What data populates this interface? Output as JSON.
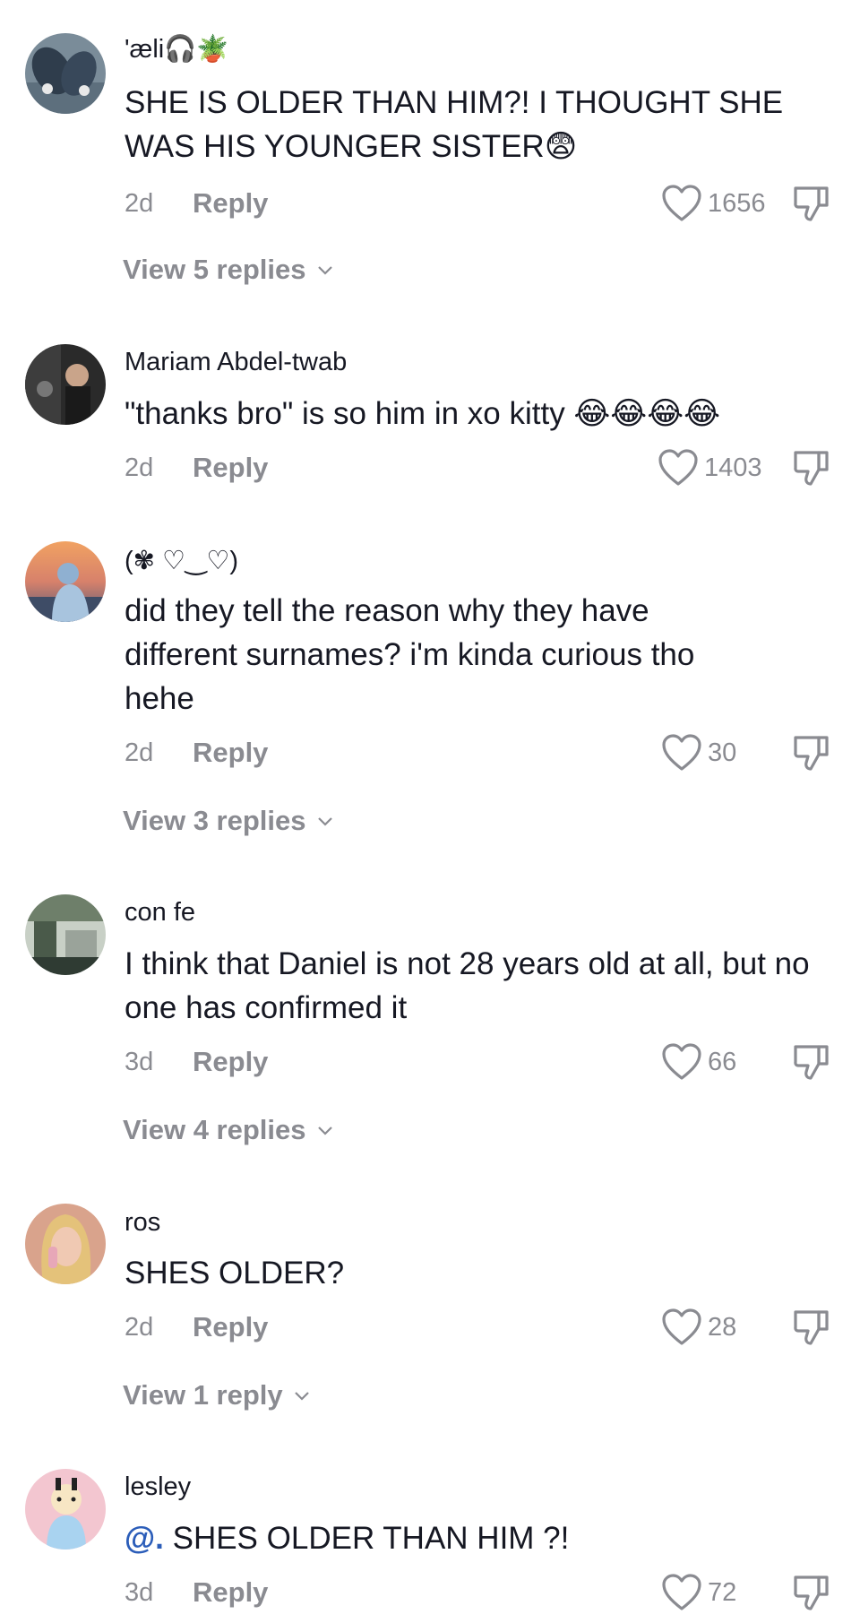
{
  "comments": [
    {
      "username": "'æli🎧🪴",
      "text": "SHE IS OLDER THAN HIM?! I THOUGHT SHE WAS HIS YOUNGER SISTER😨",
      "time": "2d",
      "reply_label": "Reply",
      "likes": "1656",
      "view_replies": "View 5 replies"
    },
    {
      "username": "Mariam Abdel-twab",
      "text": "\"thanks bro\" is so him in xo kitty 😂😂😂😂",
      "time": "2d",
      "reply_label": "Reply",
      "likes": "1403"
    },
    {
      "username": "(✾ ♡‿♡)",
      "text": "did they tell the reason why they have different surnames? i'm kinda curious tho hehe",
      "time": "2d",
      "reply_label": "Reply",
      "likes": "30",
      "view_replies": "View 3 replies"
    },
    {
      "username": "con fe",
      "text": "I think that Daniel is not 28 years old at all, but no one has confirmed it",
      "time": "3d",
      "reply_label": "Reply",
      "likes": "66",
      "view_replies": "View 4 replies"
    },
    {
      "username": "ros",
      "text": "SHES OLDER?",
      "time": "2d",
      "reply_label": "Reply",
      "likes": "28",
      "view_replies": "View 1 reply"
    },
    {
      "username": "lesley",
      "mention": "@.",
      "text": "SHES OLDER THAN HIM ?!",
      "time": "3d",
      "reply_label": "Reply",
      "likes": "72"
    }
  ],
  "icons": {
    "like": "heart-outline-icon",
    "dislike": "thumbs-down-icon",
    "expand": "chevron-down-icon"
  },
  "colors": {
    "primary_text": "#161823",
    "secondary_text": "#8a8b91",
    "mention": "#2b5db9"
  }
}
